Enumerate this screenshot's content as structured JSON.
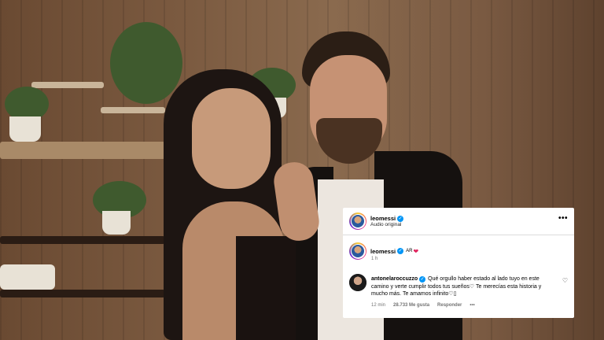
{
  "photo": {
    "description_icon": "photo"
  },
  "post": {
    "author": "leomessi",
    "audio": "Audio original",
    "caption_author": "leomessi",
    "caption_text": "AR",
    "caption_emoji": "❤",
    "caption_time": "1 h",
    "more_icon": "•••"
  },
  "comment": {
    "author": "antonelaroccuzzo",
    "text": "Qué orgullo haber estado al lado tuyo en este camino y verte cumplir todos tus sueños♡ Te merecías esta historia y mucho más. Te amamos infinito♡▯",
    "time": "12 min",
    "likes": "28.733 Me gusta",
    "reply": "Responder",
    "more": "•••",
    "like_icon": "♡"
  },
  "colors": {
    "verified": "#0095f6",
    "heart": "#e0245e"
  }
}
